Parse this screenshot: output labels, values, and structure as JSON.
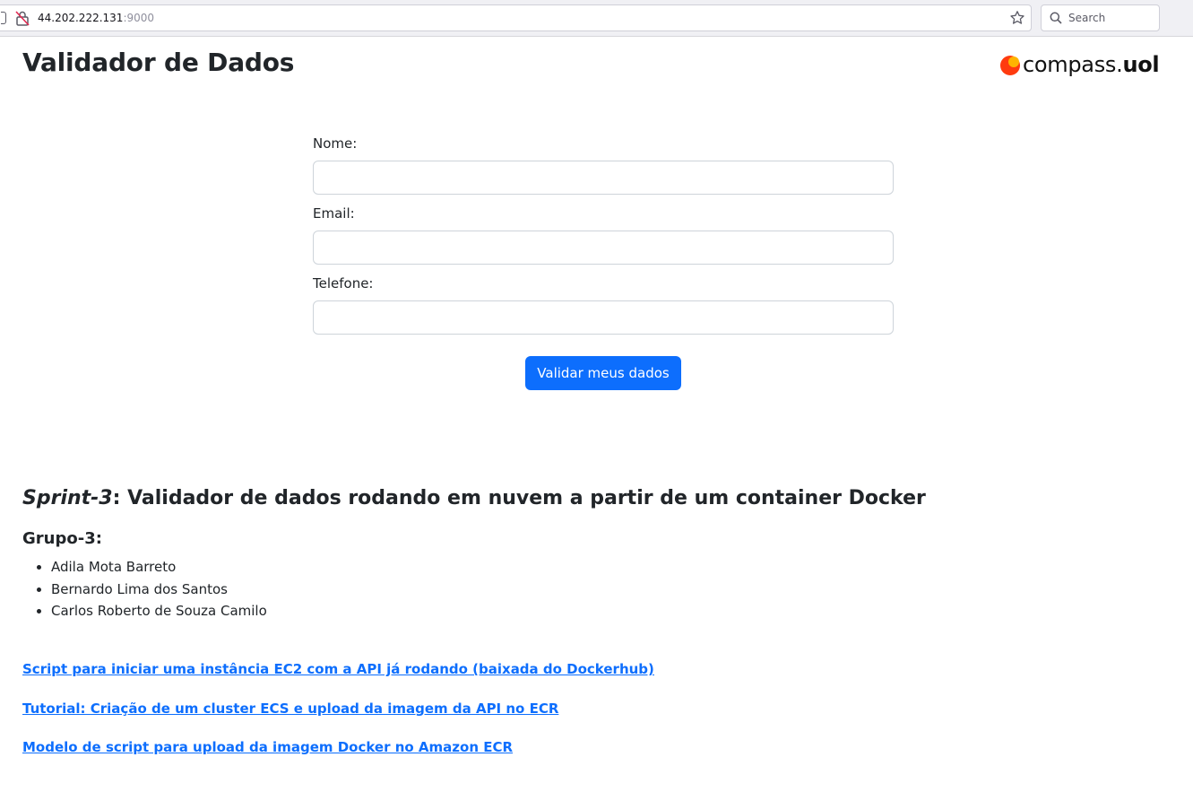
{
  "browser": {
    "url_host": "44.202.222.131",
    "url_port": ":9000",
    "search_placeholder": "Search"
  },
  "header": {
    "title": "Validador de Dados",
    "logo_text_main": "compass.",
    "logo_text_bold": "uol"
  },
  "form": {
    "fields": [
      {
        "label": "Nome:",
        "value": ""
      },
      {
        "label": "Email:",
        "value": ""
      },
      {
        "label": "Telefone:",
        "value": ""
      }
    ],
    "submit_label": "Validar meus dados",
    "accent_color": "#0d6efd"
  },
  "about": {
    "sprint_label": "Sprint-3",
    "sprint_text": ": Validador de dados rodando em nuvem a partir de um container Docker",
    "group_title": "Grupo-3:",
    "members": [
      "Adila Mota Barreto",
      "Bernardo Lima dos Santos",
      "Carlos Roberto de Souza Camilo"
    ]
  },
  "links": [
    "Script para iniciar uma instância EC2 com a API já rodando (baixada do Dockerhub)",
    "Tutorial: Criação de um cluster ECS e upload da imagem da API no ECR",
    "Modelo de script para upload da imagem Docker no Amazon ECR"
  ]
}
